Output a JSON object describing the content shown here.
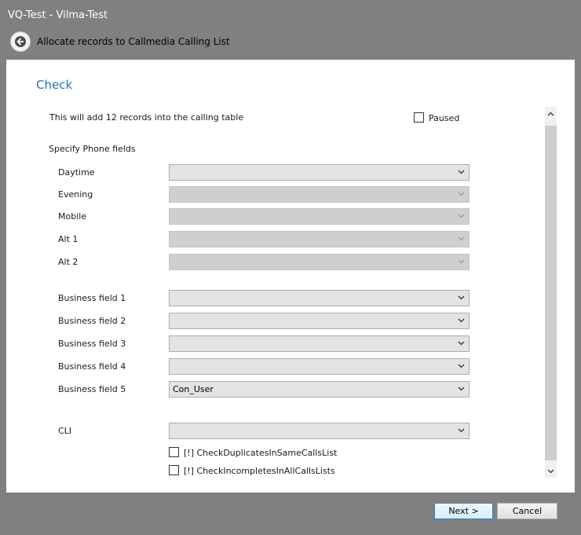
{
  "window": {
    "title": "VQ-Test - Vilma-Test"
  },
  "header": {
    "wizard_title": "Allocate records to Callmedia Calling List"
  },
  "section": {
    "title": "Check",
    "info_text": "This will add 12 records into the calling table",
    "paused_label": "Paused",
    "paused_checked": false,
    "phone_fields_heading": "Specify Phone fields"
  },
  "phone_fields": [
    {
      "label": "Daytime",
      "value": "",
      "enabled": true
    },
    {
      "label": "Evening",
      "value": "",
      "enabled": false
    },
    {
      "label": "Mobile",
      "value": "",
      "enabled": false
    },
    {
      "label": "Alt 1",
      "value": "",
      "enabled": false
    },
    {
      "label": "Alt 2",
      "value": "",
      "enabled": false
    }
  ],
  "business_fields": [
    {
      "label": "Business field 1",
      "value": ""
    },
    {
      "label": "Business field 2",
      "value": ""
    },
    {
      "label": "Business field 3",
      "value": ""
    },
    {
      "label": "Business field 4",
      "value": ""
    },
    {
      "label": "Business field 5",
      "value": "Con_User"
    }
  ],
  "cli": {
    "label": "CLI",
    "value": ""
  },
  "options": [
    {
      "label": "[!] CheckDuplicatesInSameCallsList",
      "checked": false
    },
    {
      "label": "[!] CheckIncompletesInAllCallsLists",
      "checked": false
    }
  ],
  "buttons": {
    "next": "Next >",
    "cancel": "Cancel"
  },
  "icons": {
    "back": "back-arrow-icon",
    "combo": "chevron-down-icon",
    "scroll_up": "chevron-up-icon",
    "scroll_down": "chevron-down-icon"
  },
  "colors": {
    "background": "#808080",
    "accent": "#1e73be",
    "panel": "#ffffff"
  }
}
